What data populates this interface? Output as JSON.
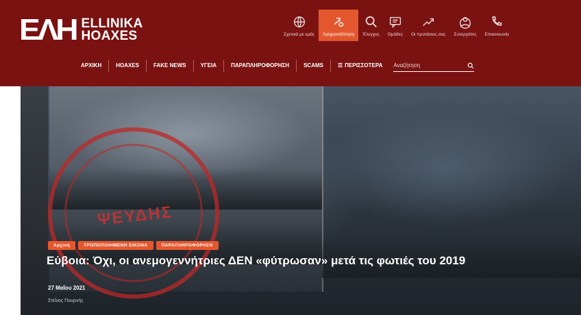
{
  "site": {
    "logo_mark": "EΛH",
    "logo_line1": "ELLINIKA",
    "logo_line2": "HOAXES",
    "brand_color": "#7a1212",
    "accent_color": "#e4572e"
  },
  "topnav": [
    {
      "label": "Σχετικά με εμάς",
      "icon": "about-globe-icon",
      "active": false
    },
    {
      "label": "Χρηματοδότηση",
      "icon": "funding-icon",
      "active": true
    },
    {
      "label": "Έλεγχος",
      "icon": "search-check-icon",
      "active": false
    },
    {
      "label": "Ομάδες",
      "icon": "chat-icon",
      "active": false
    },
    {
      "label": "Οι προτάσεις σας",
      "icon": "suggestions-icon",
      "active": false
    },
    {
      "label": "Συνεργάτες",
      "icon": "partners-icon",
      "active": false
    },
    {
      "label": "Επικοινωνία",
      "icon": "phone-icon",
      "active": false
    }
  ],
  "mainnav": [
    {
      "label": "ΑΡΧΙΚΗ"
    },
    {
      "label": "HOAXES"
    },
    {
      "label": "FAKE NEWS"
    },
    {
      "label": "ΥΓΕΙΑ"
    },
    {
      "label": "ΠΑΡΑΠΛΗΡΟΦΟΡΗΣΗ"
    },
    {
      "label": "SCAMS"
    },
    {
      "label": "ΠΕΡΙΣΣΟΤΕΡΑ"
    }
  ],
  "search": {
    "placeholder": "Αναζήτηση"
  },
  "hero": {
    "stamp_word": "ΨΕΥΔΗΣ",
    "tags": [
      "Αρχική",
      "ΤΡΟΠΟΠΟΙΗΜΕΝΗ ΕΙΚΟΝΑ",
      "ΠΑΡΑΠΛΗΡΟΦΟΡΗΣΗ"
    ],
    "headline": "Εύβοια: Όχι, οι ανεμογεννήτριες ΔΕΝ «φύτρωσαν» μετά τις φωτιές του 2019",
    "date": "27 Μαΐου 2021",
    "author": "Στέλιος Πουρνής"
  }
}
